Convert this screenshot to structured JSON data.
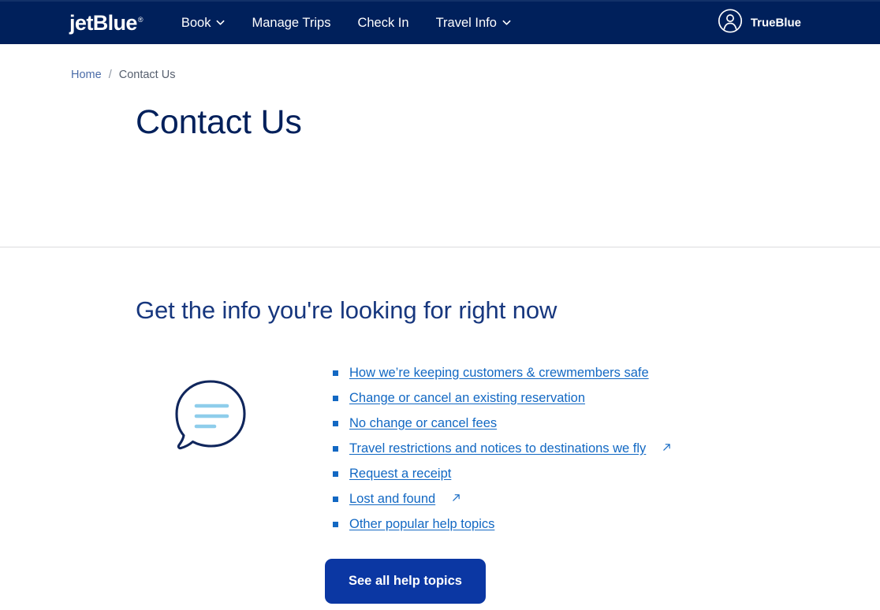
{
  "header": {
    "logo_text": "jetBlue",
    "logo_tm": "®",
    "nav": [
      {
        "label": "Book",
        "icon": "chevron-down-icon",
        "has_chevron": true
      },
      {
        "label": "Manage Trips",
        "has_chevron": false
      },
      {
        "label": "Check In",
        "has_chevron": false
      },
      {
        "label": "Travel Info",
        "icon": "chevron-down-icon",
        "has_chevron": true
      }
    ],
    "account": {
      "label": "TrueBlue",
      "icon": "user-circle-icon"
    },
    "background_color": "#00205b"
  },
  "breadcrumb": {
    "home_label": "Home",
    "separator": "/",
    "current_label": "Contact Us"
  },
  "hero": {
    "title": "Contact Us",
    "title_color": "#00205b"
  },
  "main": {
    "section_title": "Get the info you're looking for right now",
    "illustration_icon": "speech-bubble-icon",
    "help_links": [
      {
        "label": "How we’re keeping customers & crewmembers safe",
        "external": false
      },
      {
        "label": "Change or cancel an existing reservation",
        "external": false
      },
      {
        "label": "No change or cancel fees",
        "external": false
      },
      {
        "label": "Travel restrictions and notices to destinations we fly",
        "external": true
      },
      {
        "label": "Request a receipt",
        "external": false
      },
      {
        "label": "Lost and found",
        "external": true
      },
      {
        "label": "Other popular help topics",
        "external": false
      }
    ],
    "cta_button_label": "See all help topics",
    "link_color": "#1268c3",
    "button_color": "#0b37a3"
  }
}
